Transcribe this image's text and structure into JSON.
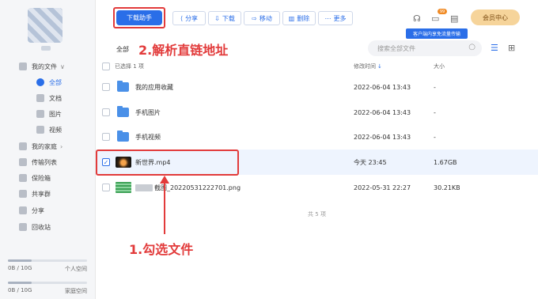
{
  "sidebar": {
    "my_files": "我的文件",
    "items": [
      {
        "label": "全部"
      },
      {
        "label": "文档"
      },
      {
        "label": "图片"
      },
      {
        "label": "视频"
      }
    ],
    "my_family": "我的家庭",
    "transfer_list": "传输列表",
    "vault": "保险箱",
    "shared_group": "共享群",
    "share": "分享",
    "recycle_bin": "回收站",
    "personal_quota": {
      "used": "0B / 10G",
      "label": "个人空间",
      "fraction": 0.3
    },
    "family_quota": {
      "used": "0B / 10G",
      "label": "家庭空间",
      "fraction": 0.3
    }
  },
  "toolbar": {
    "download_helper": "下载助手",
    "share": "分享",
    "download": "下载",
    "move": "移动",
    "delete": "删除",
    "more": "更多",
    "member_center": "会员中心",
    "badge": "99",
    "tooltip": "客户端内享免流量传输"
  },
  "annotations": {
    "step2": "2.解析直链地址",
    "step1": "1.勾选文件"
  },
  "breadcrumb": "全部",
  "search": {
    "placeholder": "搜索全部文件"
  },
  "table": {
    "headers": {
      "selected": "已选择 1 项",
      "modified": "修改时间",
      "size": "大小"
    },
    "rows": [
      {
        "name": "我的应用收藏",
        "date": "2022-06-04  13:43",
        "size": "-",
        "kind": "folder",
        "selected": false
      },
      {
        "name": "手机图片",
        "date": "2022-06-04  13:43",
        "size": "-",
        "kind": "folder",
        "selected": false
      },
      {
        "name": "手机视频",
        "date": "2022-06-04  13:43",
        "size": "-",
        "kind": "folder",
        "selected": false
      },
      {
        "name": "新世界.mp4",
        "date": "今天  23:45",
        "size": "1.67GB",
        "kind": "video",
        "selected": true
      },
      {
        "name": "截图_20220531222701.png",
        "date": "2022-05-31  22:27",
        "size": "30.21KB",
        "kind": "image",
        "selected": false
      }
    ],
    "footer": "共 5 项"
  }
}
